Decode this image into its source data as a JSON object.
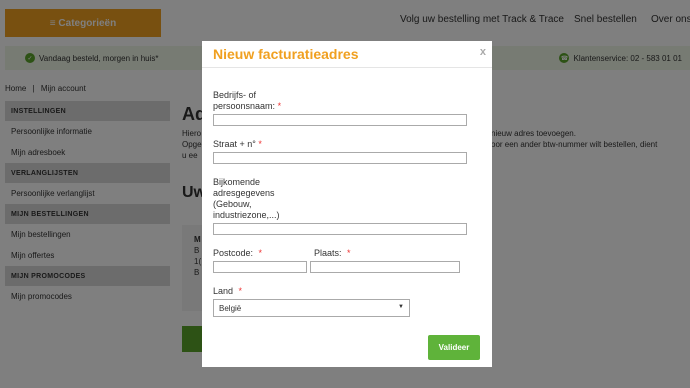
{
  "header": {
    "categories_label": "≡ Categorieën",
    "nav": [
      "Volg uw bestelling met Track & Trace",
      "Snel bestellen",
      "Over ons"
    ]
  },
  "infobar": {
    "left_text": "Vandaag besteld, morgen in huis*",
    "right_text": "Klantenservice: 02 - 583 01 01"
  },
  "breadcrumb": {
    "home": "Home",
    "separator": "|",
    "current": "Mijn account"
  },
  "sidebar": {
    "sections": [
      {
        "heading": "INSTELLINGEN",
        "items": [
          "Persoonlijke informatie",
          "Mijn adresboek"
        ]
      },
      {
        "heading": "VERLANGLIJSTEN",
        "items": [
          "Persoonlijke verlanglijst"
        ]
      },
      {
        "heading": "MIJN BESTELLINGEN",
        "items": [
          "Mijn bestellingen",
          "Mijn offertes"
        ]
      },
      {
        "heading": "MIJN PROMOCODES",
        "items": [
          "Mijn promocodes"
        ]
      }
    ]
  },
  "main": {
    "title": "Ad",
    "text_lines": [
      "Hiero",
      "Opge",
      "u ee"
    ],
    "text_right_lines": [
      "nieuw adres toevoegen.",
      "oor een ander btw-nummer wilt bestellen, dient"
    ],
    "subtitle": "Uw",
    "addr_lines": [
      "M",
      "B",
      "1(",
      "B"
    ]
  },
  "modal": {
    "title": "Nieuw facturatieadres",
    "close": "x",
    "fields": {
      "company_label": "Bedrijfs- of persoonsnaam:",
      "street_label": "Straat + n°",
      "extra_label": "Bijkomende adresgegevens (Gebouw, industriezone,...)",
      "postcode_label": "Postcode:",
      "city_label": "Plaats:",
      "country_label": "Land",
      "required_mark": "*"
    },
    "country_value": "België",
    "submit_label": "Valideer"
  },
  "colors": {
    "accent": "#f0a020",
    "green": "#5fb33a"
  }
}
